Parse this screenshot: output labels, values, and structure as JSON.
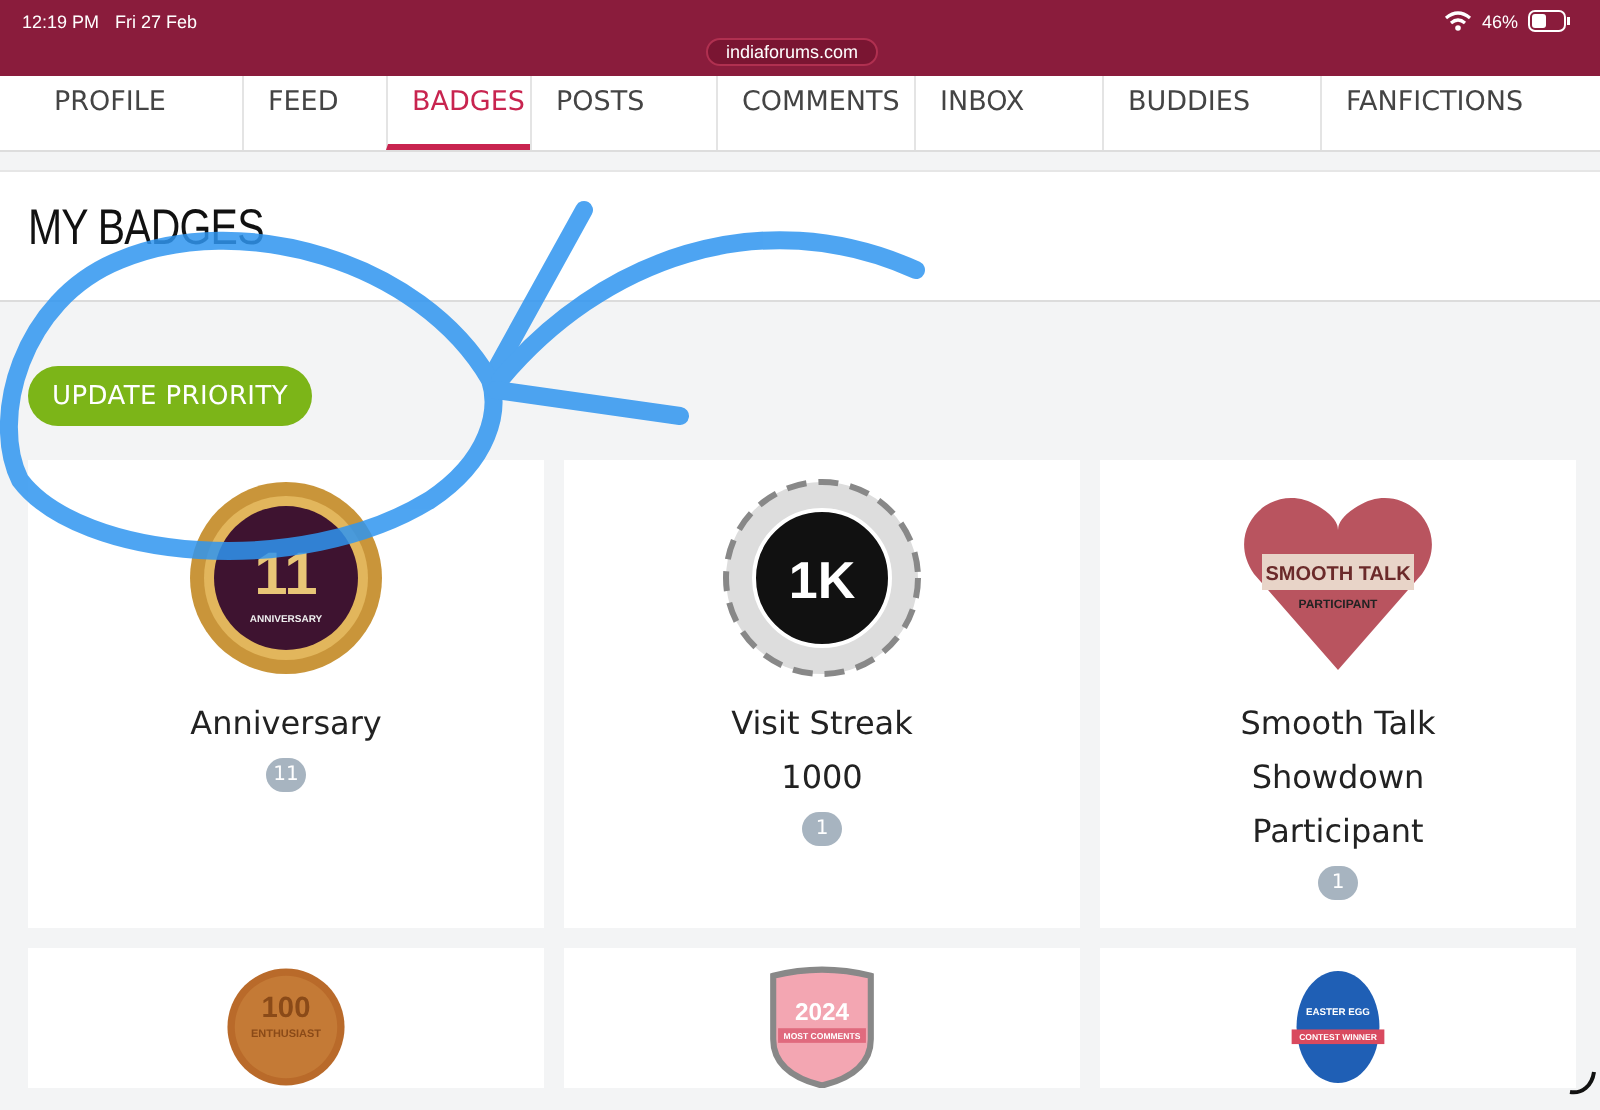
{
  "status_bar": {
    "time": "12:19 PM",
    "date": "Fri 27 Feb",
    "url": "indiaforums.com",
    "battery": "46%"
  },
  "tabs": [
    {
      "label": "PROFILE",
      "selected": false
    },
    {
      "label": "FEED",
      "selected": false
    },
    {
      "label": "BADGES",
      "selected": true
    },
    {
      "label": "POSTS",
      "selected": false
    },
    {
      "label": "COMMENTS",
      "selected": false
    },
    {
      "label": "INBOX",
      "selected": false
    },
    {
      "label": "BUDDIES",
      "selected": false
    },
    {
      "label": "FANFICTIONS",
      "selected": false
    }
  ],
  "heading": "MY BADGES",
  "update_button": "UPDATE PRIORITY",
  "badges": [
    {
      "kind": "medal",
      "emblem": "11",
      "emblem_caption": "ANNIVERSARY",
      "name": "Anniversary",
      "count": "11"
    },
    {
      "kind": "rosette",
      "emblem": "1K",
      "name": "Visit Streak 1000",
      "count": "1"
    },
    {
      "kind": "heart",
      "emblem": "SMOOTH TALK",
      "emblem_caption": "PARTICIPANT",
      "name": "Smooth Talk Showdown Participant",
      "count": "1"
    },
    {
      "kind": "coin",
      "emblem": "100",
      "emblem_caption": "ENTHUSIAST"
    },
    {
      "kind": "shield",
      "emblem": "2024",
      "emblem_caption": "MOST COMMENTS"
    },
    {
      "kind": "egg",
      "emblem": "EASTER EGG",
      "emblem_caption": "CONTEST WINNER"
    }
  ]
}
